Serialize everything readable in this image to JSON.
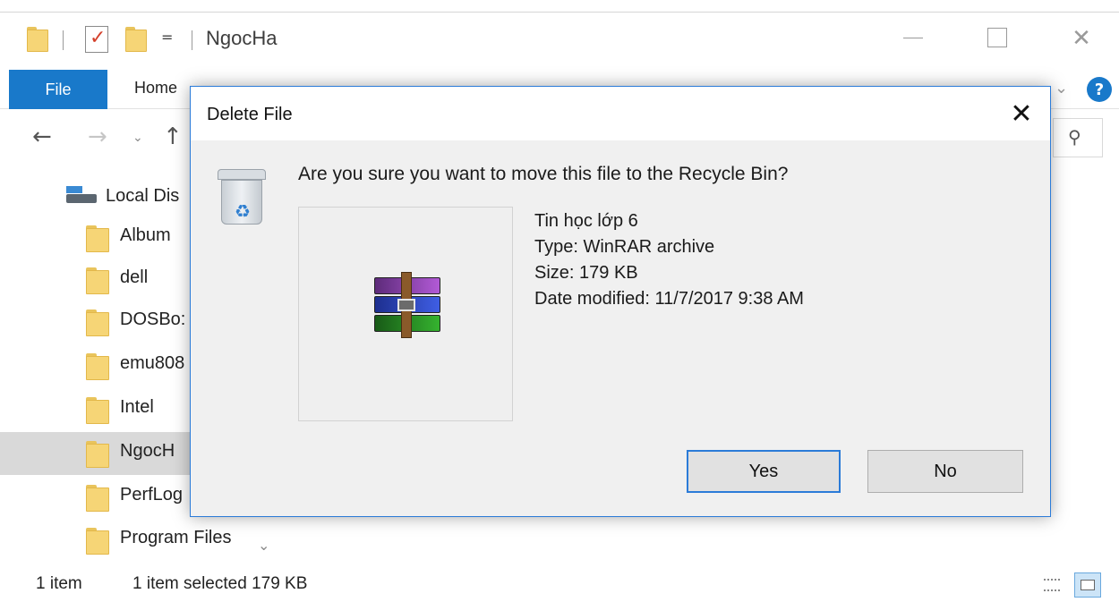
{
  "window": {
    "title": "NgocHa",
    "qa_dropdown_glyph": "=",
    "controls": {
      "minimize": "",
      "maximize": "",
      "close": "✕"
    }
  },
  "ribbon": {
    "file_tab": "File",
    "home_tab": "Home",
    "chevron": "⌄",
    "help": "?"
  },
  "nav": {
    "back": "←",
    "forward": "→",
    "recent": "⌄",
    "up": "↑",
    "search_glyph": "⚲"
  },
  "navpane": {
    "drive_label": "Local Dis",
    "items": [
      {
        "label": "Album"
      },
      {
        "label": "dell"
      },
      {
        "label": "DOSBo:"
      },
      {
        "label": "emu808"
      },
      {
        "label": "Intel"
      },
      {
        "label": "NgocH"
      },
      {
        "label": "PerfLog"
      },
      {
        "label": "Program Files"
      }
    ],
    "scroll_glyph": "⌄"
  },
  "statusbar": {
    "item_count": "1 item",
    "selection": "1 item selected  179 KB"
  },
  "dialog": {
    "title": "Delete File",
    "close": "✕",
    "question": "Are you sure you want to move this file to the Recycle Bin?",
    "file_name": "Tin học lớp 6",
    "file_type": "Type: WinRAR archive",
    "file_size": "Size: 179 KB",
    "file_date": "Date modified: 11/7/2017 9:38 AM",
    "yes_label": "Yes",
    "no_label": "No",
    "accent_color": "#2b7bd8"
  },
  "colors": {
    "file_tab": "#1979ca",
    "folder": "#f6d576",
    "selection": "#d9d9d9"
  }
}
